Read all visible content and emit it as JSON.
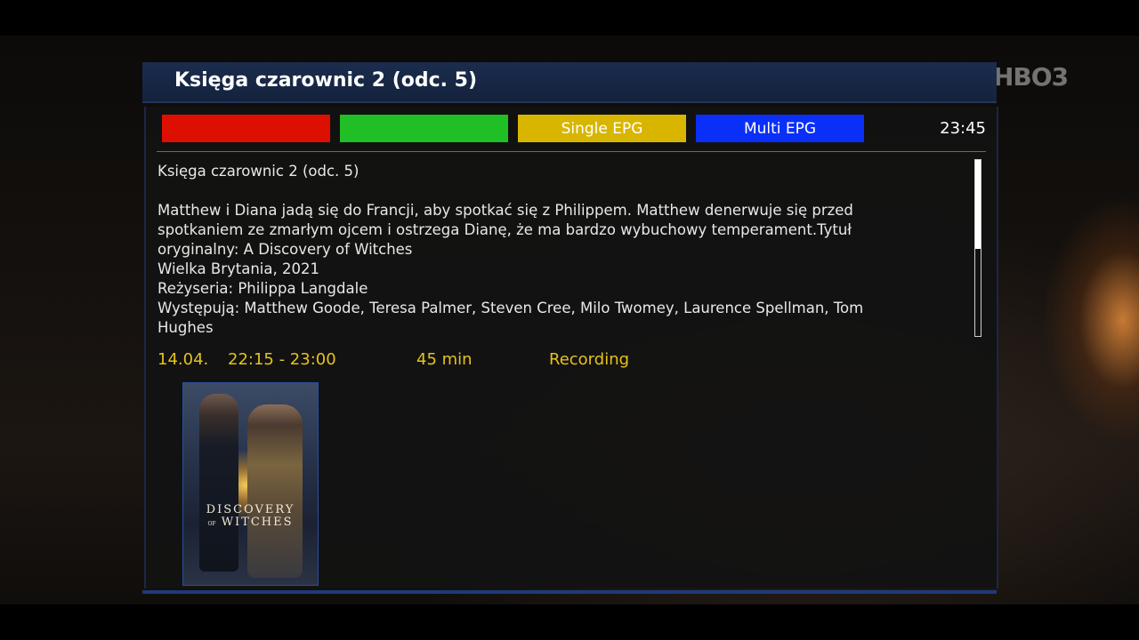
{
  "channel_logo": "HBO3",
  "panel": {
    "title": "Księga czarownic 2 (odc. 5)"
  },
  "buttons": {
    "red": {
      "label": "",
      "color": "#dd0f00"
    },
    "green": {
      "label": "",
      "color": "#1fbf25"
    },
    "yellow": {
      "label": "Single EPG",
      "color": "#d8b600"
    },
    "blue": {
      "label": "Multi EPG",
      "color": "#0a2ff8"
    }
  },
  "clock": "23:45",
  "description": {
    "heading": "Księga czarownic 2 (odc. 5)",
    "lines": [
      "Matthew i Diana jadą się do Francji, aby spotkać się z Philippem. Matthew denerwuje się przed",
      "spotkaniem ze zmarłym ojcem i ostrzega Dianę, że ma bardzo wybuchowy temperament.Tytuł",
      "oryginalny: A Discovery of Witches",
      "Wielka Brytania, 2021",
      "Reżyseria: Philippa Langdale",
      "Występują: Matthew Goode, Teresa Palmer, Steven Cree, Milo Twomey, Laurence Spellman, Tom",
      "Hughes"
    ]
  },
  "info": {
    "date": "14.04.",
    "time": "22:15 - 23:00",
    "duration": "45 min",
    "status": "Recording"
  },
  "poster": {
    "title_line1": "DISCOVERY",
    "title_small": "OF",
    "title_line2": "WITCHES"
  },
  "colors": {
    "title_bar": "#16254a",
    "info_text": "#e6c21e"
  }
}
